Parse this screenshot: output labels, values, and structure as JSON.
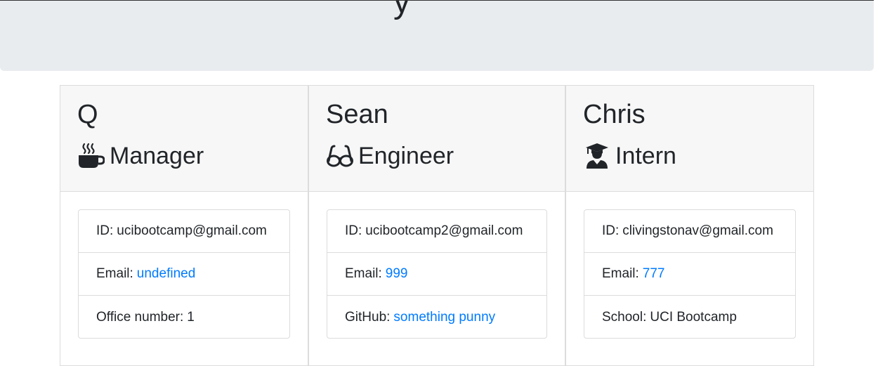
{
  "header": {
    "partial_title_glyph": "y"
  },
  "team": [
    {
      "name": "Q",
      "role": "Manager",
      "role_icon": "coffee-mug-icon",
      "id_label": "ID:",
      "id_value": "ucibootcamp@gmail.com",
      "email_label": "Email:",
      "email_value": "undefined",
      "extra_label": "Office number:",
      "extra_value": "1"
    },
    {
      "name": "Sean",
      "role": "Engineer",
      "role_icon": "glasses-icon",
      "id_label": "ID:",
      "id_value": "ucibootcamp2@gmail.com",
      "email_label": "Email:",
      "email_value": "999",
      "extra_label": "GitHub:",
      "extra_value": "something punny"
    },
    {
      "name": "Chris",
      "role": "Intern",
      "role_icon": "graduate-icon",
      "id_label": "ID:",
      "id_value": "clivingstonav@gmail.com",
      "email_label": "Email:",
      "email_value": "777",
      "extra_label": "School:",
      "extra_value": "UCI Bootcamp"
    }
  ],
  "colors": {
    "link": "#007bff",
    "jumbotron_bg": "#e9ecef",
    "card_header_bg": "#f7f7f7",
    "border": "#dcdcdc"
  }
}
